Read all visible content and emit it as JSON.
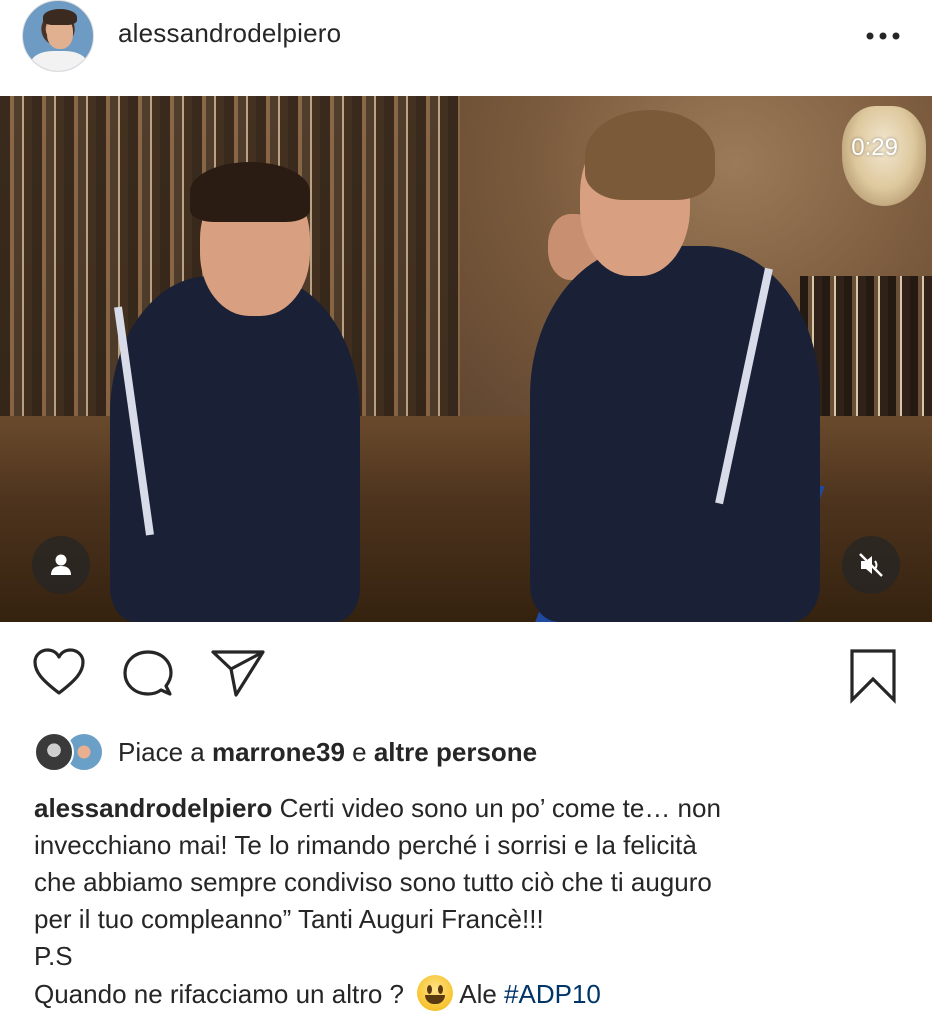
{
  "post": {
    "username": "alessandrodelpiero",
    "more_icon": "more-horizontal-icon",
    "media": {
      "type": "video",
      "timer": "0:29",
      "tag_icon": "user-tag-icon",
      "mute_icon": "volume-muted-icon"
    },
    "actions": {
      "like_icon": "heart-icon",
      "comment_icon": "comment-icon",
      "share_icon": "send-icon",
      "save_icon": "bookmark-icon"
    },
    "likes": {
      "prefix": "Piace a ",
      "user": "marrone39",
      "middle": " e ",
      "suffix": "altre persone"
    },
    "caption": {
      "user": "alessandrodelpiero",
      "line1": " Certi video sono un po’ come te… non",
      "line2": "invecchiano mai! Te lo rimando perché i sorrisi e la felicità",
      "line3": "che abbiamo sempre condiviso sono tutto ciò che ti auguro",
      "line4": "per il tuo compleanno” Tanti Auguri Francè!!!",
      "line5": "P.S",
      "line6_text": "Quando ne rifacciamo un altro ?",
      "line6_emoji": "😃",
      "line6_after": "Ale ",
      "hashtag": "#ADP10"
    }
  },
  "colors": {
    "text": "#262626",
    "hashtag": "#003569",
    "overlay_button": "#262626"
  }
}
